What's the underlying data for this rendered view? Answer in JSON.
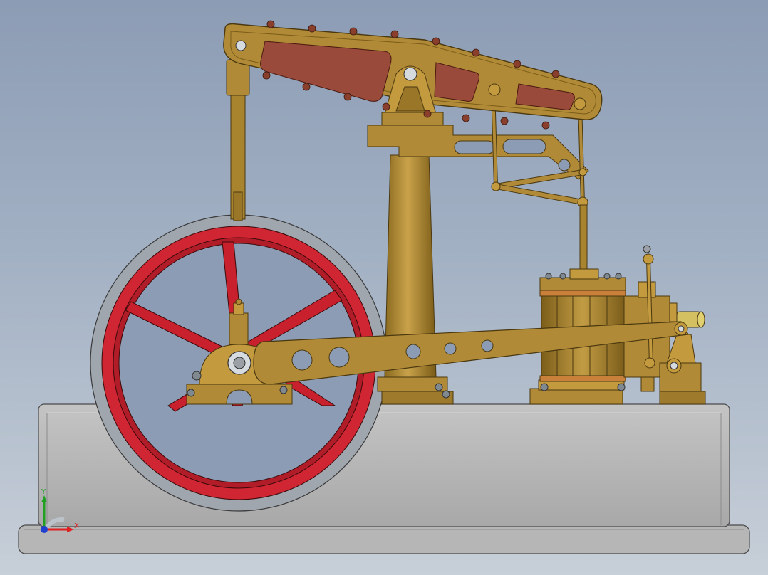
{
  "viewport": {
    "background_top": "#8c9cb4",
    "background_bottom": "#c7cfd8"
  },
  "model": {
    "colors": {
      "brass": "#b08a36",
      "brass_dark": "#6e5316",
      "flywheel_red": "#c8202c",
      "flywheel_rim": "#9aa0a8",
      "beam_panel": "#9a4a3a",
      "base": "#b2b2b2",
      "rivet": "#7a3a2a"
    }
  },
  "triad": {
    "x_label": "X",
    "y_label": "Y",
    "x_color": "#e02020",
    "y_color": "#20a020",
    "z_color": "#2040d0"
  }
}
